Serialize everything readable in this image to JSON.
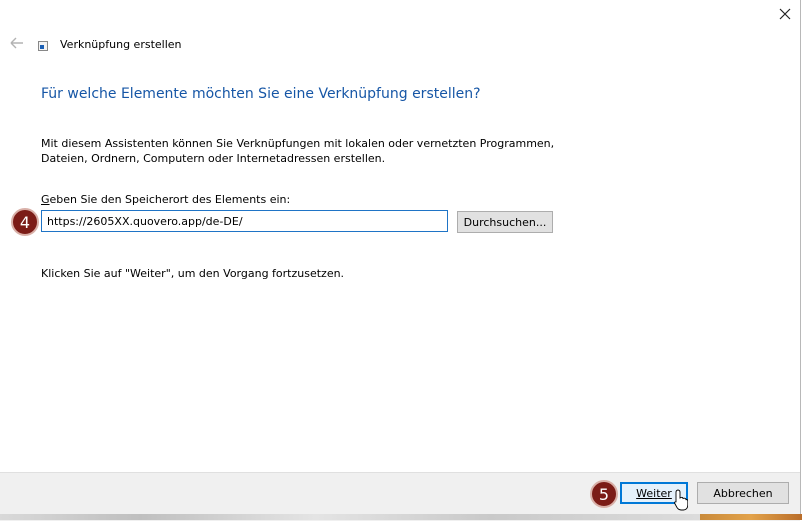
{
  "window": {
    "title": "Verknüpfung erstellen",
    "close_glyph": "✕"
  },
  "page": {
    "heading": "Für welche Elemente möchten Sie eine Verknüpfung erstellen?",
    "description": "Mit diesem Assistenten können Sie Verknüpfungen mit lokalen oder vernetzten Programmen, Dateien, Ordnern, Computern oder Internetadressen erstellen.",
    "location_label_accel": "G",
    "location_label_rest": "eben Sie den Speicherort des Elements ein:",
    "location_value": "https://2605XX.quovero.app/de-DE/",
    "browse_label": "Durchsuchen...",
    "hint": "Klicken Sie auf \"Weiter\", um den Vorgang fortzusetzen."
  },
  "footer": {
    "next_label": "Weiter",
    "cancel_label": "Abbrechen"
  },
  "annotations": {
    "step4": "4",
    "step5": "5"
  },
  "icons": {
    "back": "back-arrow-icon",
    "close": "close-icon",
    "app": "shortcut-icon",
    "cursor": "mouse-pointer-icon"
  },
  "colors": {
    "heading": "#1656a6",
    "input_border": "#1f74c6",
    "badge": "#7b1c17",
    "primary_button_border": "#0078d7"
  }
}
